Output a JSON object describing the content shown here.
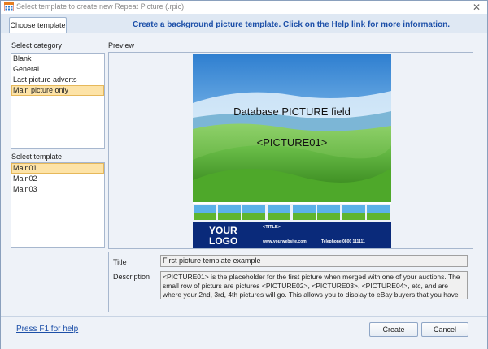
{
  "window": {
    "title": "Select template to create new Repeat Picture (.rpic)",
    "close_icon": "close-icon",
    "app_icon": "calendar-grid-icon"
  },
  "tabs": [
    {
      "label": "Choose template",
      "active": true
    }
  ],
  "header_message": "Create a background picture template.  Click on the Help link for more information.",
  "category": {
    "label": "Select category",
    "items": [
      "Blank",
      "General",
      "Last picture adverts",
      "Main picture only"
    ],
    "selected": "Main picture only"
  },
  "template": {
    "label": "Select template",
    "items": [
      "Main01",
      "Main02",
      "Main03"
    ],
    "selected": "Main01"
  },
  "preview": {
    "label": "Preview",
    "field_caption": "Database PICTURE field",
    "placeholder": "<PICTURE01>",
    "logo_line1": "YOUR",
    "logo_line2": "LOGO",
    "title_tag": "<TITLE>",
    "website": "www.yourwebsite.com",
    "telephone": "Telephone 0800 111111",
    "colors": {
      "sky": "#3e8cd6",
      "grass": "#5fb52e",
      "banner": "#0a2a7a"
    }
  },
  "details": {
    "title_label": "Title",
    "title_value": "First picture template example",
    "description_label": "Description",
    "description_value": "<PICTURE01> is the placeholder for the first picture when merged with one of your auctions.  The small row of picturs are pictures <PICTURE02>, <PICTURE03>, <PICTURE04>, etc, and are where your 2nd, 3rd, 4th pictures will go.  This allows you to display to eBay buyers that you have taken the"
  },
  "footer": {
    "help_link": "Press F1 for help",
    "create_label": "Create",
    "cancel_label": "Cancel"
  }
}
